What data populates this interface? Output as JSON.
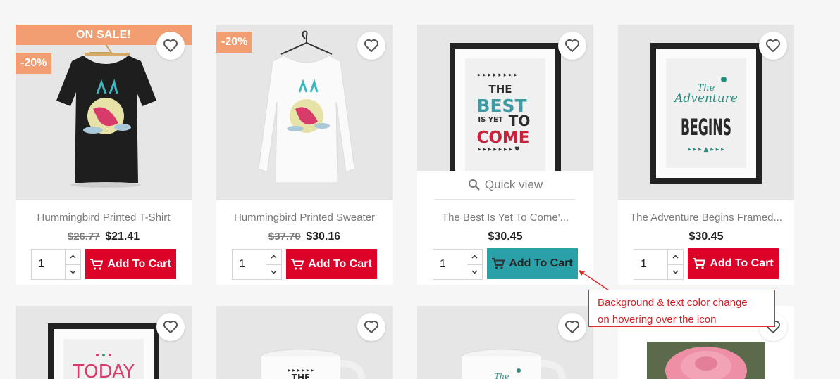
{
  "products": [
    {
      "name": "Hummingbird Printed T-Shirt",
      "old_price": "$26.77",
      "price": "$21.41",
      "badge": "ON SALE!",
      "discount": "-20%",
      "qty": "1",
      "cart_label": "Add To Cart"
    },
    {
      "name": "Hummingbird Printed Sweater",
      "old_price": "$37.70",
      "price": "$30.16",
      "discount": "-20%",
      "qty": "1",
      "cart_label": "Add To Cart"
    },
    {
      "name": "The Best Is Yet To Come'...",
      "price": "$30.45",
      "qty": "1",
      "cart_label": "Add To Cart",
      "quick_view": "Quick view"
    },
    {
      "name": "The Adventure Begins Framed...",
      "price": "$30.45",
      "qty": "1",
      "cart_label": "Add To Cart"
    }
  ],
  "posters": {
    "best": {
      "line1": "THE",
      "line2": "BEST",
      "line3": "IS YET",
      "line4": "TO",
      "line5": "COME"
    },
    "adventure": {
      "line1": "The",
      "line2": "Adventure",
      "line3": "BEGINS"
    },
    "today": {
      "line1": "TODAY"
    },
    "mug1": {
      "line1": "THE"
    },
    "mug2": {
      "line1": "The"
    }
  },
  "annotation": {
    "line1": "Background & text color change",
    "line2": "on hovering over the icon"
  },
  "colors": {
    "accent": "#dd0227",
    "hover": "#2aa0a8",
    "sale": "#f39d72",
    "annotation": "#e02c2c"
  },
  "icons": [
    "heart-icon",
    "search-icon",
    "cart-icon",
    "chevron-up-icon",
    "chevron-down-icon"
  ]
}
